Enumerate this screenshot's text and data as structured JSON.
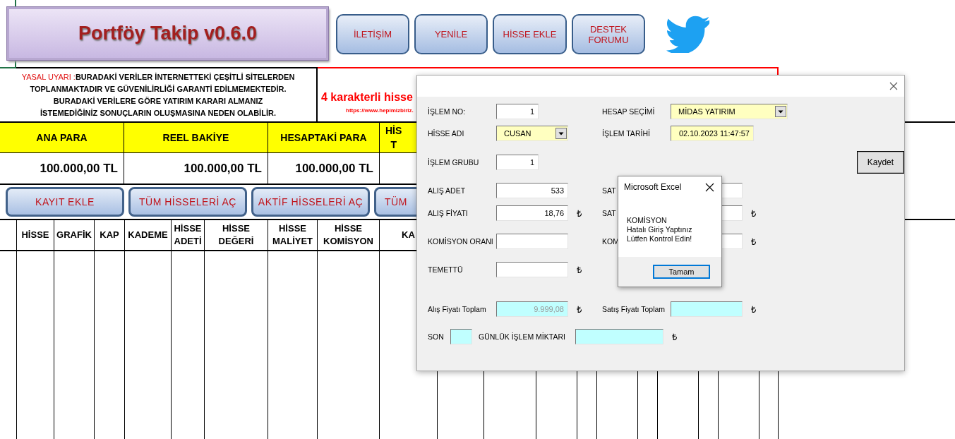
{
  "title_button": "Portföy Takip v0.6.0",
  "top_buttons": [
    "İLETİŞİM",
    "YENİLE",
    "HİSSE EKLE",
    "DESTEK FORUMU"
  ],
  "disclaimer": {
    "label": "YASAL UYARI :",
    "lines": [
      "BURADAKİ VERİLER İNTERNETTEKİ ÇEŞİTLİ SİTELERDEN",
      "TOPLANMAKTADIR VE GÜVENİLİRLİĞİ GARANTİ EDİLMEMEKTEDİR.",
      "BURADAKİ VERİLERE GÖRE YATIRIM KARARI ALMANIZ",
      "İSTEMEDİĞİNİZ SONUÇLARIN OLUŞMASINA NEDEN OLABİLİR."
    ]
  },
  "notice": {
    "text": "4 karakterli hisse",
    "link": "https://www.hepimizbiriz."
  },
  "summary": [
    {
      "header": [
        "ANA PARA"
      ],
      "value": "100.000,00 TL"
    },
    {
      "header": [
        "REEL BAKİYE"
      ],
      "value": "100.000,00 TL"
    },
    {
      "header": [
        "HESAPTAKİ PARA"
      ],
      "value": "100.000,00 TL"
    },
    {
      "header": [
        "HİS",
        "T"
      ]
    }
  ],
  "action_buttons": [
    "KAYIT EKLE",
    "TÜM HİSSELERİ AÇ",
    "AKTİF HİSSELERİ AÇ",
    "TÜM"
  ],
  "table": {
    "columns": [
      "HİSSE",
      "GRAFİK",
      "KAP",
      "KADEME",
      "HİSSE ADETİ",
      "HİSSE DEĞERİ",
      "HİSSE MALİYET",
      "HİSSE KOMİSYON",
      "KA"
    ]
  },
  "form": {
    "rows": [
      {
        "left": {
          "label": "İŞLEM  NO:",
          "field": {
            "kind": "text",
            "value": "1",
            "disabled": false
          }
        },
        "right": {
          "label": "HESAP SEÇİMİ",
          "field": {
            "kind": "combo",
            "value": "MİDAS YATIRIM",
            "color": "#ffffc0",
            "disabled": false
          }
        }
      },
      {
        "left": {
          "label": "HİSSE ADI",
          "field": {
            "kind": "combo",
            "value": "CUSAN",
            "color": "#ffffc0",
            "disabled": false
          }
        },
        "right": {
          "label": "İŞLEM TARİHİ",
          "field": {
            "kind": "text",
            "value": "02.10.2023 11:47:57",
            "color": "#ffffc0",
            "disabled": false
          }
        }
      },
      {
        "left": {
          "label": "İŞLEM  GRUBU",
          "field": {
            "kind": "text",
            "value": "1",
            "disabled": false
          }
        },
        "right": {
          "button": "Kaydet"
        }
      },
      {
        "left": {
          "label": "ALIŞ ADET",
          "field": {
            "kind": "text",
            "value": "533",
            "disabled": false
          }
        },
        "right": {
          "label": "SAT",
          "field": {
            "kind": "text"
          }
        }
      },
      {
        "left": {
          "label": "ALIŞ FİYATI",
          "field": {
            "kind": "text",
            "value": "18,76",
            "disabled": false
          },
          "unit": "₺"
        },
        "right": {
          "label": "SAT",
          "field": {
            "kind": "text"
          },
          "unit": "₺"
        }
      },
      {
        "left": {
          "label": "KOMİSYON ORANI",
          "field": {
            "kind": "text"
          }
        },
        "right": {
          "label": "KOM",
          "field": {
            "kind": "text"
          },
          "unit": "₺"
        }
      },
      {
        "left": {
          "label": "TEMETTÜ",
          "field": {
            "kind": "text"
          },
          "unit": "₺"
        }
      },
      {
        "left": {
          "label": "Alış Fiyatı Toplam",
          "field": {
            "kind": "text",
            "value": "9.999,08",
            "color": "#c0ffff",
            "disabled": true
          },
          "unit": "₺"
        },
        "right": {
          "label": "Satış Fiyatı Toplam",
          "field": {
            "kind": "text",
            "color": "#c0ffff"
          },
          "unit": "₺"
        }
      }
    ],
    "footer": {
      "label": "SON",
      "field": {
        "color": "#c0ffff"
      },
      "label_2": "GÜNLÜK İŞLEM MİKTARI",
      "field_2": {
        "color": "#c0ffff"
      },
      "unit": "₺"
    }
  },
  "message_box": {
    "title": "Microsoft Excel",
    "message": [
      "KOMİSYON",
      "Hatalı Giriş Yaptınız",
      "Lütfen Kontrol Edin!"
    ],
    "button": "Tamam"
  }
}
